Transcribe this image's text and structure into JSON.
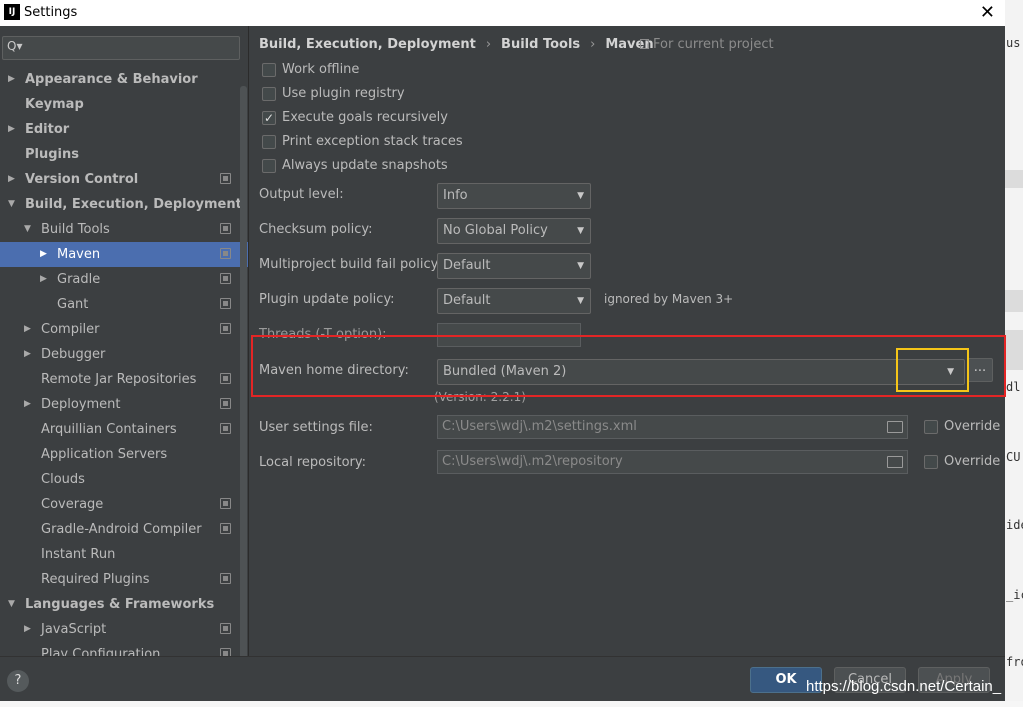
{
  "window": {
    "title": "Settings",
    "app_icon": "IJ",
    "close_icon": "✕"
  },
  "search": {
    "icon": "Q▾"
  },
  "tree": [
    {
      "label": "Appearance & Behavior",
      "level": 0,
      "arrow": "right",
      "bold": true,
      "copy": false
    },
    {
      "label": "Keymap",
      "level": 0,
      "arrow": "none",
      "bold": true,
      "copy": false
    },
    {
      "label": "Editor",
      "level": 0,
      "arrow": "right",
      "bold": true,
      "copy": false
    },
    {
      "label": "Plugins",
      "level": 0,
      "arrow": "none",
      "bold": true,
      "copy": false
    },
    {
      "label": "Version Control",
      "level": 0,
      "arrow": "right",
      "bold": true,
      "copy": true
    },
    {
      "label": "Build, Execution, Deployment",
      "level": 0,
      "arrow": "down",
      "bold": true,
      "copy": false
    },
    {
      "label": "Build Tools",
      "level": 1,
      "arrow": "down",
      "bold": false,
      "copy": true
    },
    {
      "label": "Maven",
      "level": 2,
      "arrow": "right",
      "bold": false,
      "copy": true,
      "selected": true
    },
    {
      "label": "Gradle",
      "level": 2,
      "arrow": "right",
      "bold": false,
      "copy": true
    },
    {
      "label": "Gant",
      "level": 2,
      "arrow": "none",
      "bold": false,
      "copy": true
    },
    {
      "label": "Compiler",
      "level": 1,
      "arrow": "right",
      "bold": false,
      "copy": true
    },
    {
      "label": "Debugger",
      "level": 1,
      "arrow": "right",
      "bold": false,
      "copy": false
    },
    {
      "label": "Remote Jar Repositories",
      "level": 1,
      "arrow": "none",
      "bold": false,
      "copy": true
    },
    {
      "label": "Deployment",
      "level": 1,
      "arrow": "right",
      "bold": false,
      "copy": true
    },
    {
      "label": "Arquillian Containers",
      "level": 1,
      "arrow": "none",
      "bold": false,
      "copy": true
    },
    {
      "label": "Application Servers",
      "level": 1,
      "arrow": "none",
      "bold": false,
      "copy": false
    },
    {
      "label": "Clouds",
      "level": 1,
      "arrow": "none",
      "bold": false,
      "copy": false
    },
    {
      "label": "Coverage",
      "level": 1,
      "arrow": "none",
      "bold": false,
      "copy": true
    },
    {
      "label": "Gradle-Android Compiler",
      "level": 1,
      "arrow": "none",
      "bold": false,
      "copy": true
    },
    {
      "label": "Instant Run",
      "level": 1,
      "arrow": "none",
      "bold": false,
      "copy": false
    },
    {
      "label": "Required Plugins",
      "level": 1,
      "arrow": "none",
      "bold": false,
      "copy": true
    },
    {
      "label": "Languages & Frameworks",
      "level": 0,
      "arrow": "down",
      "bold": true,
      "copy": false
    },
    {
      "label": "JavaScript",
      "level": 1,
      "arrow": "right",
      "bold": false,
      "copy": true
    },
    {
      "label": "Play Configuration",
      "level": 1,
      "arrow": "none",
      "bold": false,
      "copy": true
    }
  ],
  "breadcrumb": {
    "part1": "Build, Execution, Deployment",
    "part2": "Build Tools",
    "part3": "Maven",
    "sep": "›",
    "scope": "For current project"
  },
  "checkboxes": [
    {
      "label": "Work offline",
      "checked": false
    },
    {
      "label": "Use plugin registry",
      "checked": false
    },
    {
      "label": "Execute goals recursively",
      "checked": true
    },
    {
      "label": "Print exception stack traces",
      "checked": false
    },
    {
      "label": "Always update snapshots",
      "checked": false
    }
  ],
  "fields": {
    "output_level": {
      "label": "Output level:",
      "value": "Info"
    },
    "checksum_policy": {
      "label": "Checksum policy:",
      "value": "No Global Policy"
    },
    "multiproject_fail": {
      "label": "Multiproject build fail policy:",
      "value": "Default"
    },
    "plugin_update": {
      "label": "Plugin update policy:",
      "value": "Default",
      "hint": "ignored by Maven 3+"
    },
    "threads": {
      "label": "Threads (-T option):",
      "value": ""
    },
    "maven_home": {
      "label": "Maven home directory:",
      "value": "Bundled (Maven 2)",
      "browse": "...",
      "version": "(Version: 2.2.1)"
    },
    "user_settings": {
      "label": "User settings file:",
      "value": "C:\\Users\\wdj\\.m2\\settings.xml",
      "override": "Override"
    },
    "local_repo": {
      "label": "Local repository:",
      "value": "C:\\Users\\wdj\\.m2\\repository",
      "override": "Override"
    }
  },
  "footer": {
    "help": "?",
    "ok": "OK",
    "cancel": "Cancel",
    "apply": "Apply"
  },
  "watermark": "https://blog.csdn.net/Certain_",
  "background_text": [
    "us",
    "dl",
    "CU",
    "ide",
    "_ic",
    "fro"
  ]
}
